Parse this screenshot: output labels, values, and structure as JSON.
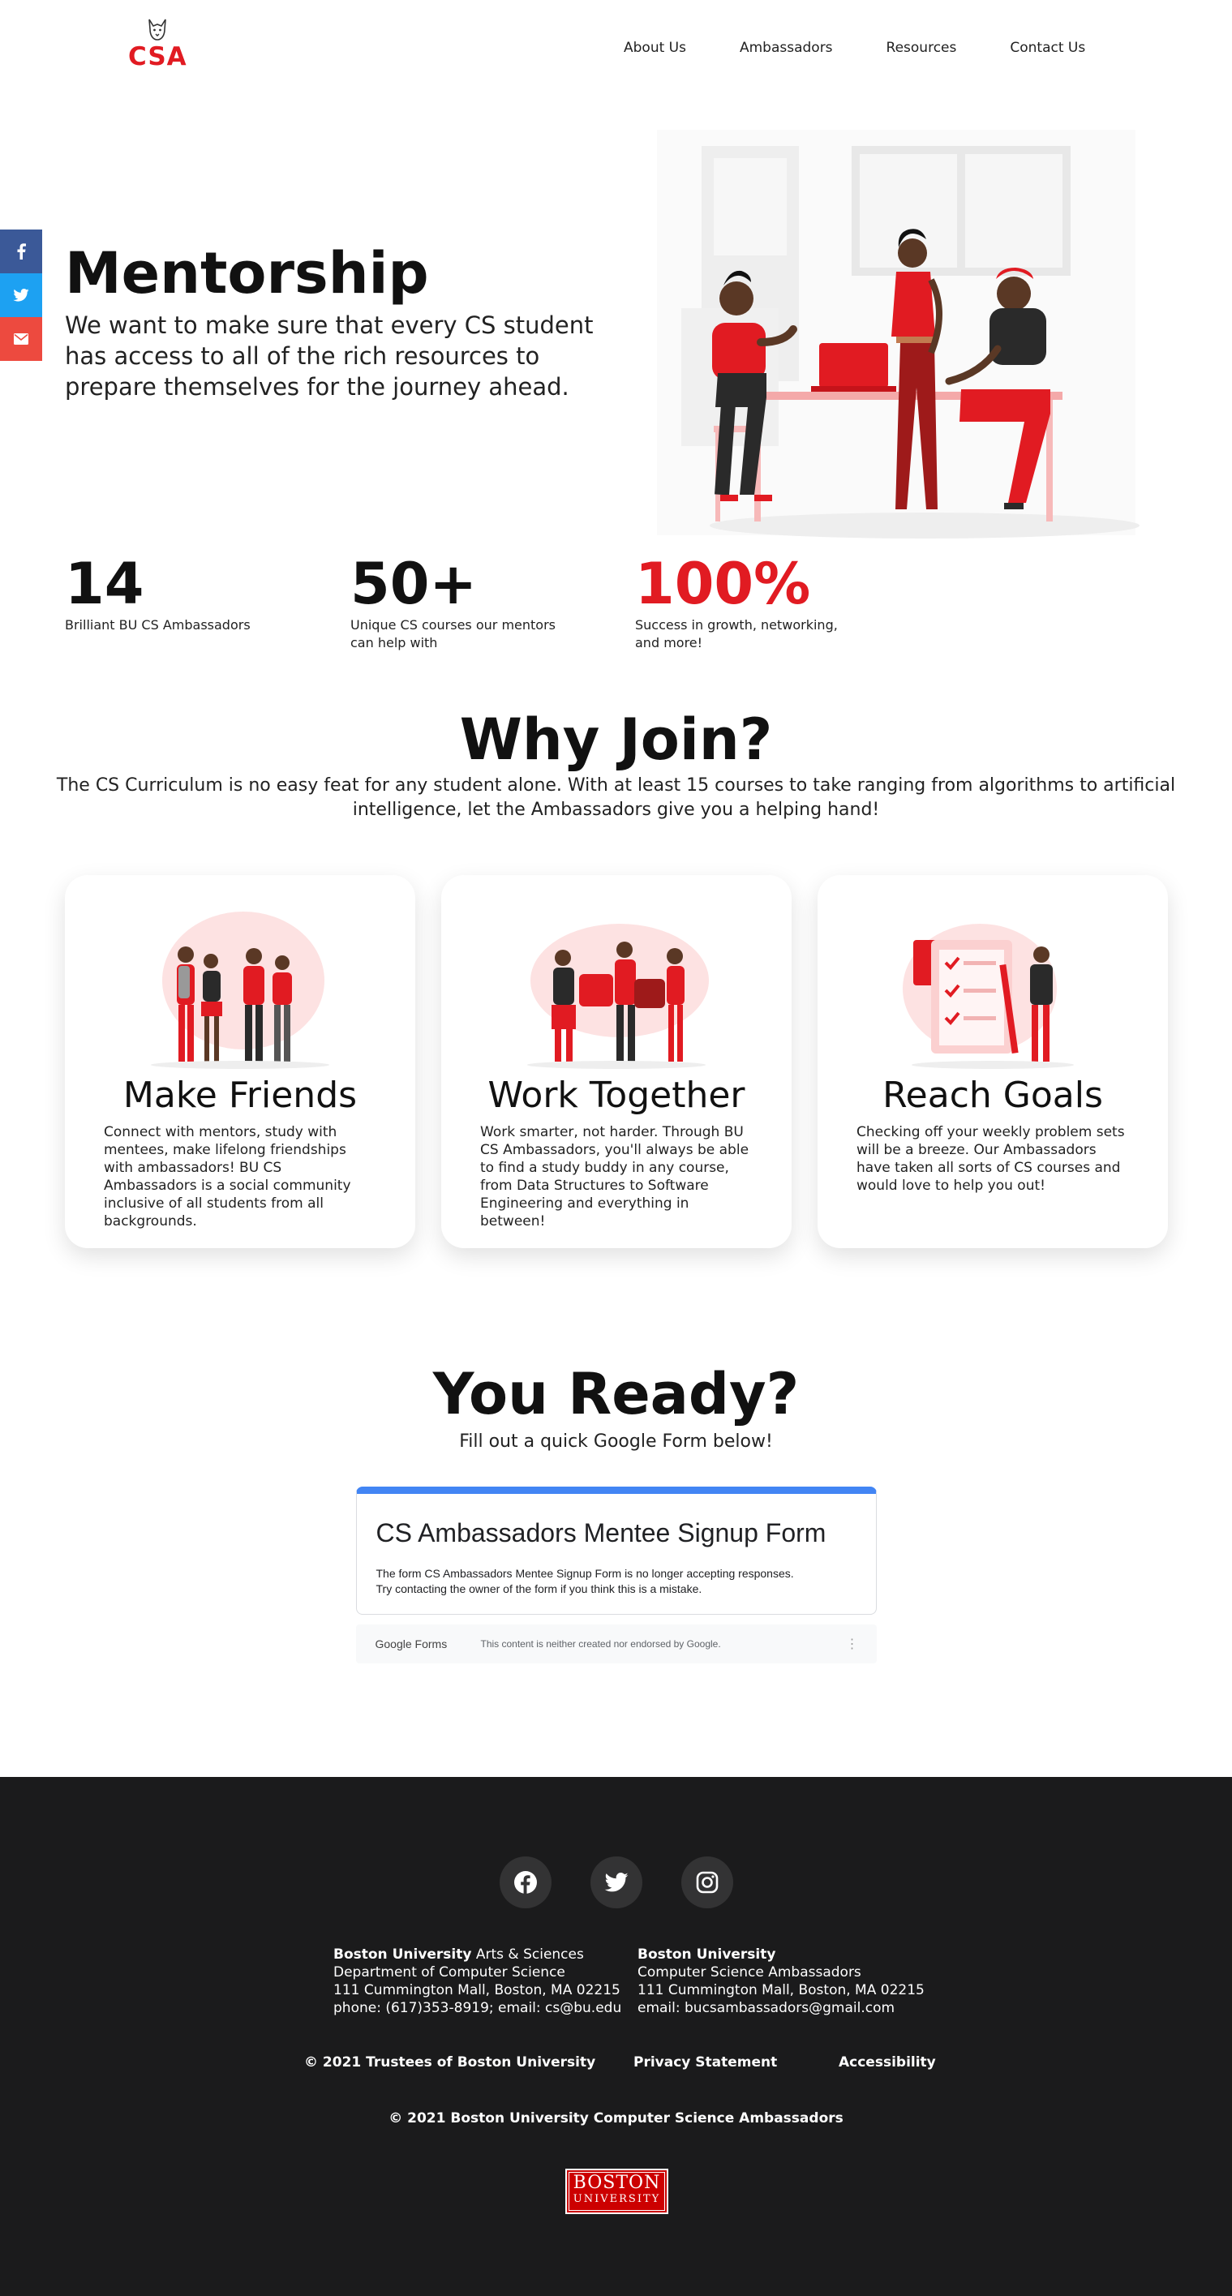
{
  "header": {
    "logo_text": "CSA",
    "nav": [
      "About Us",
      "Ambassadors",
      "Resources",
      "Contact Us"
    ]
  },
  "social_sidebar": [
    "facebook-icon",
    "twitter-icon",
    "email-icon"
  ],
  "hero": {
    "title": "Mentorship",
    "subtitle": "We want to make sure that every CS student has access to all of the rich resources to prepare themselves for the journey ahead."
  },
  "stats": [
    {
      "value": "14",
      "label": "Brilliant BU CS Ambassadors"
    },
    {
      "value": "50+",
      "label": "Unique CS courses our mentors can help with"
    },
    {
      "value": "100%",
      "label": "Success in growth, networking, and more!"
    }
  ],
  "why": {
    "title": "Why Join?",
    "description": "The CS Curriculum is no easy feat for any student alone. With at least 15 courses to take ranging from algorithms to artificial intelligence, let the Ambassadors give you a helping hand!",
    "cards": [
      {
        "title": "Make Friends",
        "text": "Connect with mentors, study with mentees, make lifelong friendships with ambassadors! BU CS Ambassadors is a social community inclusive of all students from all backgrounds."
      },
      {
        "title": "Work Together",
        "text": "Work smarter, not harder. Through BU CS Ambassadors, you'll always be able to find a study buddy in any course, from Data Structures to Software Engineering and everything in between!"
      },
      {
        "title": "Reach Goals",
        "text": "Checking off your weekly problem sets will be a breeze. Our Ambassadors have taken all sorts of CS courses and would love to help you out!"
      }
    ]
  },
  "ready": {
    "title": "You Ready?",
    "subtitle": "Fill out a quick Google Form below!",
    "form": {
      "title": "CS Ambassadors Mentee Signup Form",
      "message_line1": "The form CS Ambassadors Mentee Signup Form is no longer accepting responses.",
      "message_line2": "Try contacting the owner of the form if you think this is a mistake.",
      "footer_brand": "Google Forms",
      "footer_note": "This content is neither created nor endorsed by Google."
    }
  },
  "footer": {
    "social": [
      "facebook-icon",
      "twitter-icon",
      "instagram-icon"
    ],
    "col1": {
      "title_bold": "Boston University",
      "title_rest": " Arts & Sciences",
      "line2": "Department of Computer Science",
      "line3": "111 Cummington Mall, Boston, MA 02215",
      "line4": "phone: (617)353-8919; email: cs@bu.edu"
    },
    "col2": {
      "title_bold": "Boston University",
      "line2": "Computer Science Ambassadors",
      "line3": "111 Cummington Mall, Boston, MA 02215",
      "line4": "email: bucsambassadors@gmail.com"
    },
    "links": [
      "© 2021 Trustees of Boston University",
      "Privacy Statement",
      "Accessibility"
    ],
    "copyright": "© 2021 Boston University Computer Science Ambassadors",
    "bu_logo_line1": "BOSTON",
    "bu_logo_line2": "UNIVERSITY"
  },
  "colors": {
    "accent_red": "#e11b22",
    "footer_bg": "#1b1b1c",
    "facebook": "#3b5998",
    "twitter": "#1da1f2",
    "email": "#ed4a3f",
    "google_blue": "#4285f4"
  }
}
